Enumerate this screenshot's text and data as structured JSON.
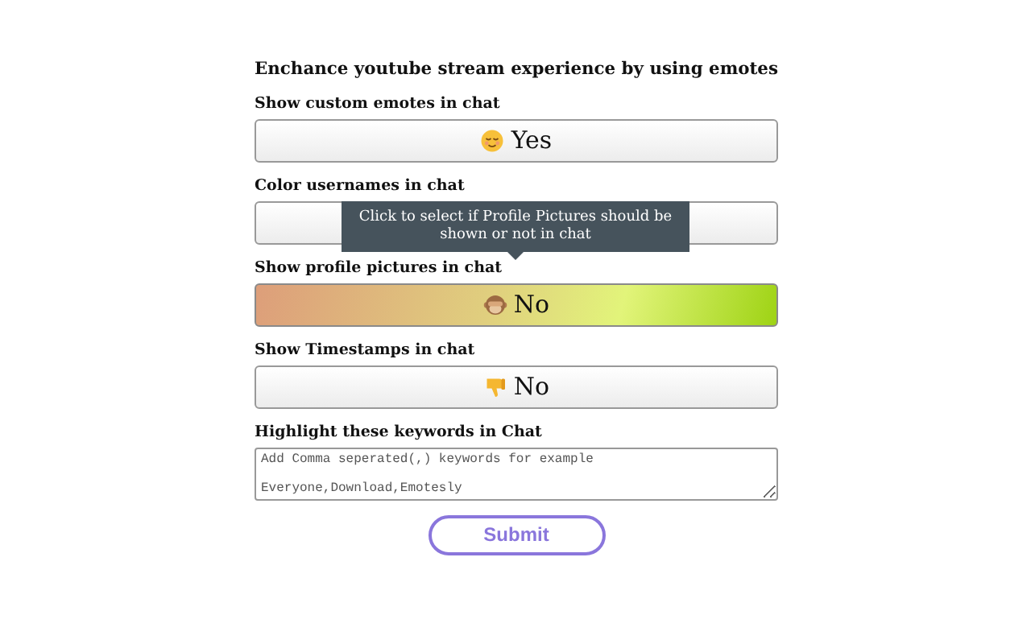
{
  "title": "Enchance youtube stream experience by using emotes",
  "toggles": [
    {
      "label": "Show custom emotes in chat",
      "value": "Yes",
      "highlighted": false
    },
    {
      "label": "Color usernames in chat",
      "highlighted": false
    },
    {
      "label": "Show profile pictures in chat",
      "value": "No",
      "highlighted": true
    },
    {
      "label": "Show Timestamps in chat",
      "value": "No",
      "highlighted": false
    }
  ],
  "tooltip": "Click to select if Profile Pictures should be shown or not in chat",
  "keywords": {
    "label": "Highlight these keywords in Chat",
    "placeholder": "Add Comma seperated(,) keywords for example\n\nEveryone,Download,Emotesly"
  },
  "submit": "Submit"
}
